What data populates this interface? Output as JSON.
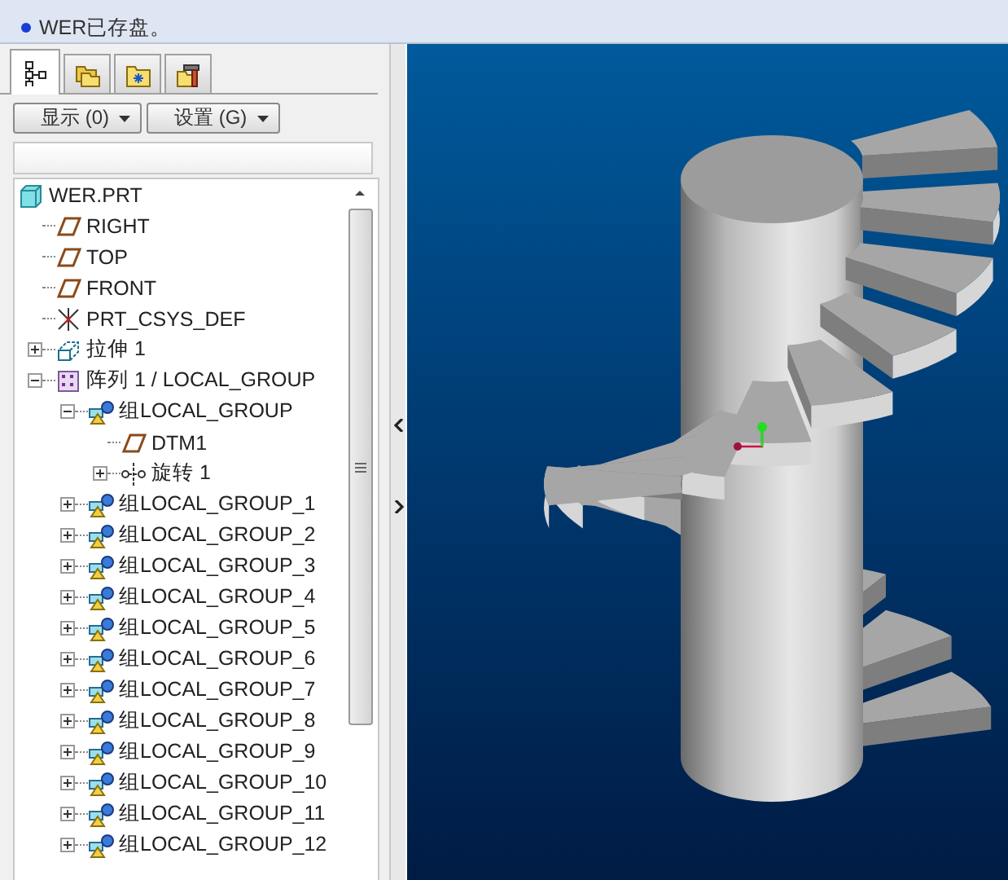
{
  "message_area": {
    "messages": [
      {
        "text": "WER已存盘。"
      }
    ]
  },
  "navigator_tabs": [
    {
      "kind": "model-tree",
      "selected": true
    },
    {
      "kind": "folders",
      "selected": false
    },
    {
      "kind": "favorites",
      "selected": false
    },
    {
      "kind": "tools",
      "selected": false
    }
  ],
  "tree_toolbar": {
    "buttons": [
      {
        "label": "显示 (0)"
      },
      {
        "label": "设置 (G)"
      }
    ]
  },
  "model_tree": {
    "items": [
      {
        "label": "WER.PRT",
        "kind": "part",
        "children": [
          {
            "label": "RIGHT",
            "kind": "plane"
          },
          {
            "label": "TOP",
            "kind": "plane"
          },
          {
            "label": "FRONT",
            "kind": "plane"
          },
          {
            "label": "PRT_CSYS_DEF",
            "kind": "csys"
          },
          {
            "label": "拉伸 1",
            "kind": "extrude",
            "expanded": false
          },
          {
            "label": "阵列 1 / LOCAL_GROUP",
            "kind": "pattern",
            "expanded": true,
            "children": [
              {
                "label": "组LOCAL_GROUP",
                "kind": "group",
                "expanded": true,
                "children": [
                  {
                    "label": "DTM1",
                    "kind": "plane"
                  },
                  {
                    "label": "旋转 1",
                    "kind": "revolve",
                    "expanded": false
                  }
                ]
              },
              {
                "label": "组LOCAL_GROUP_1",
                "kind": "group",
                "expanded": false
              },
              {
                "label": "组LOCAL_GROUP_2",
                "kind": "group",
                "expanded": false
              },
              {
                "label": "组LOCAL_GROUP_3",
                "kind": "group",
                "expanded": false
              },
              {
                "label": "组LOCAL_GROUP_4",
                "kind": "group",
                "expanded": false
              },
              {
                "label": "组LOCAL_GROUP_5",
                "kind": "group",
                "expanded": false
              },
              {
                "label": "组LOCAL_GROUP_6",
                "kind": "group",
                "expanded": false
              },
              {
                "label": "组LOCAL_GROUP_7",
                "kind": "group",
                "expanded": false
              },
              {
                "label": "组LOCAL_GROUP_8",
                "kind": "group",
                "expanded": false
              },
              {
                "label": "组LOCAL_GROUP_9",
                "kind": "group",
                "expanded": false
              },
              {
                "label": "组LOCAL_GROUP_10",
                "kind": "group",
                "expanded": false
              },
              {
                "label": "组LOCAL_GROUP_11",
                "kind": "group",
                "expanded": false
              },
              {
                "label": "组LOCAL_GROUP_12",
                "kind": "group",
                "expanded": false
              }
            ]
          }
        ]
      }
    ]
  }
}
